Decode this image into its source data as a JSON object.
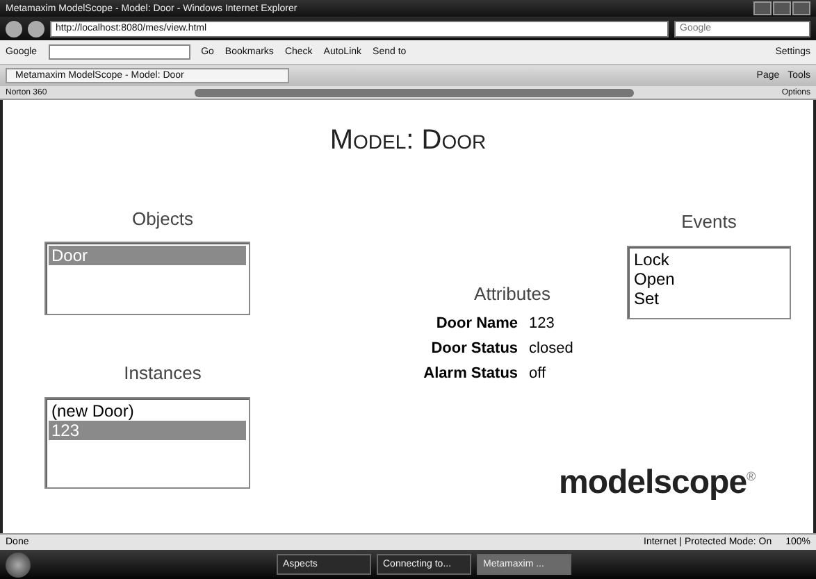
{
  "browser": {
    "title": "Metamaxim ModelScope - Model: Door - Windows Internet Explorer",
    "address": "http://localhost:8080/mes/view.html",
    "search_placeholder": "Google",
    "tab": "Metamaxim ModelScope - Model: Door",
    "google": "Google",
    "go": "Go",
    "toolbar": [
      "Bookmarks",
      "Check",
      "AutoLink",
      "Send to"
    ],
    "settings": "Settings",
    "commands": [
      "Page",
      "Tools"
    ],
    "norton": "Norton 360",
    "options": "Options"
  },
  "page": {
    "title": "Model: Door",
    "objects": {
      "heading": "Objects",
      "items": [
        {
          "label": "Door",
          "selected": true
        }
      ]
    },
    "instances": {
      "heading": "Instances",
      "items": [
        {
          "label": "(new Door)",
          "selected": false
        },
        {
          "label": "123",
          "selected": true
        }
      ]
    },
    "events": {
      "heading": "Events",
      "items": [
        {
          "label": "Lock",
          "selected": false
        },
        {
          "label": "Open",
          "selected": false
        },
        {
          "label": "Set",
          "selected": false
        }
      ]
    },
    "attributes": {
      "heading": "Attributes",
      "rows": [
        {
          "name": "Door Name",
          "value": "123"
        },
        {
          "name": "Door Status",
          "value": "closed"
        },
        {
          "name": "Alarm Status",
          "value": "off"
        }
      ]
    },
    "logo": {
      "text": "modelscope",
      "mark": "®"
    }
  },
  "status_bar": {
    "text": "Done",
    "zone": "Internet | Protected Mode: On",
    "zoom": "100%"
  },
  "taskbar": [
    {
      "label": "Aspects",
      "selected": false
    },
    {
      "label": "Connecting to...",
      "selected": false
    },
    {
      "label": "Metamaxim ...",
      "selected": true
    }
  ]
}
